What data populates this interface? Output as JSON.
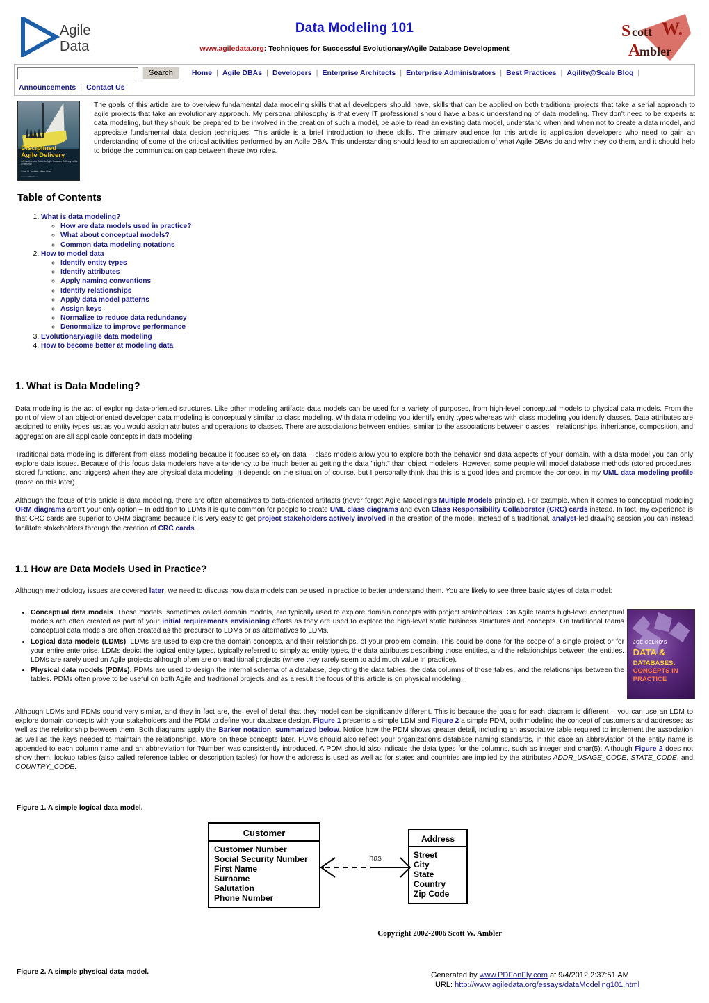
{
  "header": {
    "logo_left_line1": "Agile",
    "logo_left_line2": "Data",
    "title": "Data Modeling 101",
    "tagline_domain": "www.agiledata.org",
    "tagline_rest": ": Techniques for Successful Evolutionary/Agile Database Development",
    "logo_right_line1": "Scott W.",
    "logo_right_line2": "Ambler",
    "accent_blue": "#1414c8",
    "accent_red": "#b01010"
  },
  "nav": {
    "search_value": "",
    "search_placeholder": "",
    "search_button": "Search",
    "row1": [
      "Home",
      "Agile DBAs",
      "Developers",
      "Enterprise Architects",
      "Enterprise Administrators",
      "Best Practices",
      "Agility@Scale Blog"
    ],
    "row2": [
      "Announcements",
      "Contact Us"
    ]
  },
  "intro": {
    "book_cover": {
      "title_line1": "Disciplined",
      "title_line2": "Agile Delivery",
      "subtitle": "A Practitioner's Guide to Agile Software Delivery in the Enterprise",
      "authors": "Scott W. Ambler · Mark Lines",
      "publisher": "Pearson/IBM Press"
    },
    "paragraph": "The goals of this article are to overview fundamental data modeling skills that all developers should have, skills that can be applied on both traditional projects that take a serial approach to agile projects that take an evolutionary approach.  My personal philosophy is that every IT professional should have a basic understanding of data modeling.  They don't need to be experts at data modeling, but they should be prepared to be involved in the creation of such a model, be able to read an existing data model, understand when and when not to create a data model, and appreciate fundamental data design techniques.  This article is a brief introduction to these skills.  The primary audience for this article is application developers who need to gain an understanding of some of the critical activities performed by an Agile DBA.  This understanding should lead to an appreciation of what Agile DBAs do and why they do them, and it should help to bridge the communication gap between these two roles."
  },
  "toc": {
    "heading": "Table of Contents",
    "items": [
      {
        "label": "What is data modeling?",
        "children": [
          "How are data models used in practice?",
          "What about conceptual models?",
          "Common data modeling notations"
        ]
      },
      {
        "label": "How to model data",
        "children": [
          "Identify entity types",
          "Identify attributes",
          "Apply naming conventions",
          "Identify relationships",
          "Apply data model patterns",
          "Assign keys",
          "Normalize to reduce data redundancy",
          "Denormalize to improve performance"
        ]
      },
      {
        "label": "Evolutionary/agile data modeling",
        "children": []
      },
      {
        "label": "How to become better at modeling data",
        "children": []
      }
    ]
  },
  "section1": {
    "heading": "1. What is Data Modeling?",
    "p1_a": "Data modeling is the act of exploring data-oriented structures.  Like other modeling artifacts data models can be used for a variety of purposes, from high-level conceptual models to physical data models. From the point of view of an object-oriented developer data modeling is conceptually similar to class modeling. With data modeling you identify entity types whereas with class modeling you identify classes. Data attributes are assigned to entity types just as you would assign attributes and operations to classes.  There are associations between entities, similar to the associations between classes – relationships, inheritance, composition, and aggregation are all applicable concepts in data modeling.",
    "p2_a": "Traditional data modeling is different from class modeling because it focuses solely on data – class models allow you to explore both the behavior and data aspects of your domain, with a data model you can only explore data issues.  Because of this focus data modelers have a tendency to be much better at getting the data \"right\" than object modelers.  However, some people will model database methods (stored procedures, stored functions, and triggers) when they are physical data modeling.  It depends on the situation of course, but I personally think that this is a good idea and promote the concept in my ",
    "p2_link": "UML data modeling profile",
    "p2_b": " (more on this later).",
    "p3_a": "Although the focus of this article is data modeling, there are often alternatives to data-oriented artifacts (never forget Agile Modeling's ",
    "p3_link1": "Multiple Models",
    "p3_b": " principle).  For example, when it comes to conceptual modeling ",
    "p3_link2": "ORM diagrams",
    "p3_c": " aren't your only option – In addition to LDMs it is quite common for people to create ",
    "p3_link3": "UML class diagrams",
    "p3_d": " and even ",
    "p3_link4": "Class Responsibility Collaborator (CRC) cards",
    "p3_e": " instead.  In fact, my experience is that CRC cards are superior to ORM diagrams because it is very easy to get ",
    "p3_link5": "project stakeholders actively involved",
    "p3_f": " in the creation of the model.  Instead of a traditional, ",
    "p3_link6": "analyst",
    "p3_g": "-led drawing session you can instead facilitate stakeholders through the creation of ",
    "p3_link7": "CRC cards",
    "p3_h": "."
  },
  "section11": {
    "heading": "1.1 How are Data Models Used in Practice?",
    "p1_a": "Although methodology issues are covered ",
    "p1_link": "later",
    "p1_b": ", we need to discuss how data models can be used in practice to better understand them.   You are likely to see three basic styles of data model:",
    "bullets": [
      {
        "term": "Conceptual data models",
        "text_a": ".  These models, sometimes called domain models, are typically used to explore domain concepts with project stakeholders.  On Agile teams high-level conceptual models are often created as part of your ",
        "link": "initial requirements envisioning",
        "text_b": " efforts as they are used to explore the high-level static business structures and concepts.  On traditional teams conceptual data models are often created as the precursor to LDMs or as alternatives to LDMs."
      },
      {
        "term": "Logical data models (LDMs)",
        "text_a": ".  LDMs are used to explore the domain concepts, and their relationships, of your problem domain.  This could be done for the scope of a single project or for your entire enterprise.  LDMs depict the logical entity types, typically referred to simply as entity types, the data attributes describing those entities, and the relationships between the entities. LDMs are rarely used on Agile projects although often are on traditional projects (where they rarely seem to add much value in practice).",
        "link": "",
        "text_b": ""
      },
      {
        "term": "Physical data models (PDMs)",
        "text_a": ".  PDMs are used to design the internal schema of a database, depicting the data tables, the data columns of those tables, and the relationships between the tables. PDMs often prove to be useful on both Agile and traditional projects and as a result the focus of this article is on physical modeling.",
        "link": "",
        "text_b": ""
      }
    ],
    "book_cover": {
      "author_line": "JOE CELKO'S",
      "title_line1": "DATA &",
      "title_line2": "DATABASES:",
      "title_line3": "CONCEPTS IN",
      "title_line4": "PRACTICE"
    },
    "p2_a": "Although LDMs and PDMs sound very similar, and they in fact are, the level of detail that they model can be significantly different.  This is because the goals for each diagram is different – you can use an LDM to explore domain concepts with your stakeholders and the PDM to define your database design.  ",
    "p2_link1": "Figure 1",
    "p2_b": " presents a simple LDM and ",
    "p2_link2": "Figure 2",
    "p2_c": " a simple PDM, both modeling the concept of customers and addresses as well as the relationship between them.  Both diagrams apply the ",
    "p2_link3": "Barker notation",
    "p2_d": ", ",
    "p2_link4": "summarized below",
    "p2_e": ".  Notice how the PDM shows greater detail, including an associative table required to implement the association as well as the keys needed to maintain the relationships.  More on these concepts later.  PDMs should also reflect your organization's database naming standards, in this case an abbreviation of the entity name is appended to each column name and an abbreviation for 'Number' was consistently introduced.  A PDM should also indicate the data types for the columns, such as integer and char(5).  Although ",
    "p2_link5": "Figure 2",
    "p2_f": " does not show them, lookup tables (also called reference tables or description tables) for how the address is used as well as for states and countries are implied by the attributes ",
    "p2_italic1": "ADDR_USAGE_CODE",
    "p2_g": ", ",
    "p2_italic2": "STATE_CODE",
    "p2_h": ", and ",
    "p2_italic3": "COUNTRY_CODE",
    "p2_i": "."
  },
  "figures": {
    "fig1_caption": "Figure 1. A simple logical data model.",
    "fig2_caption": "Figure 2. A simple physical data model.",
    "diagram": {
      "entity1_name": "Customer",
      "entity1_attributes": [
        "Customer Number",
        "Social Security Number",
        "First Name",
        "Surname",
        "Salutation",
        "Phone Number"
      ],
      "entity2_name": "Address",
      "entity2_attributes": [
        "Street",
        "City",
        "State",
        "Country",
        "Zip Code"
      ],
      "relationship_label": "has",
      "copyright": "Copyright 2002-2006 Scott W. Ambler"
    }
  },
  "footer": {
    "generated_prefix": "Generated by ",
    "generated_link": "www.PDFonFly.com",
    "generated_suffix": " at 9/4/2012 2:37:51 AM",
    "url_prefix": "URL: ",
    "url_link": "http://www.agiledata.org/essays/dataModeling101.html"
  }
}
